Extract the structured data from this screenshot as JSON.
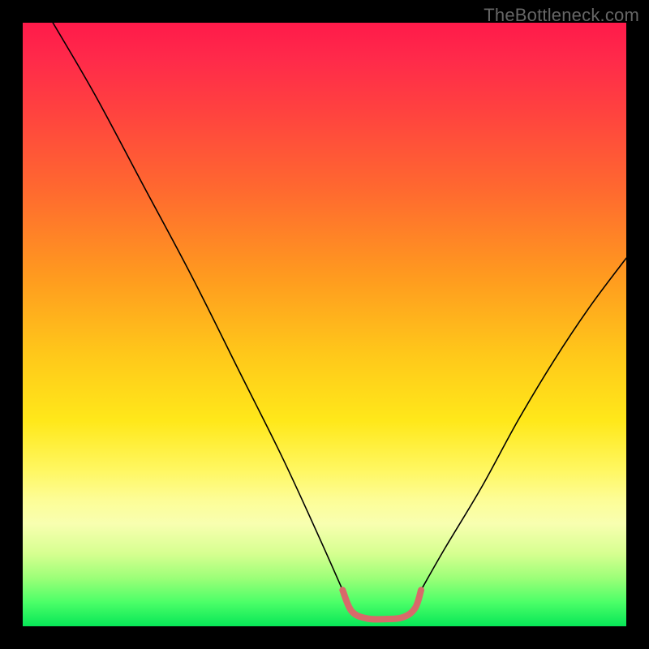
{
  "watermark": "TheBottleneck.com",
  "chart_data": {
    "type": "line",
    "title": "",
    "xlabel": "",
    "ylabel": "",
    "xlim": [
      0,
      100
    ],
    "ylim": [
      0,
      100
    ],
    "grid": false,
    "series": [
      {
        "name": "left-arm",
        "stroke": "#000000",
        "stroke_width": 1.6,
        "points": [
          {
            "x": 5,
            "y": 100
          },
          {
            "x": 12,
            "y": 88
          },
          {
            "x": 20,
            "y": 73
          },
          {
            "x": 28,
            "y": 58
          },
          {
            "x": 36,
            "y": 42
          },
          {
            "x": 43,
            "y": 28
          },
          {
            "x": 49,
            "y": 15
          },
          {
            "x": 53,
            "y": 6
          }
        ]
      },
      {
        "name": "right-arm",
        "stroke": "#000000",
        "stroke_width": 1.6,
        "points": [
          {
            "x": 66,
            "y": 6
          },
          {
            "x": 70,
            "y": 13
          },
          {
            "x": 76,
            "y": 23
          },
          {
            "x": 82,
            "y": 34
          },
          {
            "x": 88,
            "y": 44
          },
          {
            "x": 94,
            "y": 53
          },
          {
            "x": 100,
            "y": 61
          }
        ]
      },
      {
        "name": "bottom-highlight",
        "stroke": "#d86a6a",
        "stroke_width": 8,
        "points": [
          {
            "x": 53,
            "y": 6
          },
          {
            "x": 54.5,
            "y": 2.5
          },
          {
            "x": 57,
            "y": 1.3
          },
          {
            "x": 60,
            "y": 1.2
          },
          {
            "x": 63,
            "y": 1.5
          },
          {
            "x": 65,
            "y": 3
          },
          {
            "x": 66,
            "y": 6
          }
        ]
      }
    ],
    "background": {
      "type": "vertical-gradient",
      "stops": [
        {
          "pos": 0,
          "color": "#ff1a4a"
        },
        {
          "pos": 14,
          "color": "#ff4040"
        },
        {
          "pos": 42,
          "color": "#ff9a1f"
        },
        {
          "pos": 66,
          "color": "#ffe81a"
        },
        {
          "pos": 83,
          "color": "#f8ffb0"
        },
        {
          "pos": 100,
          "color": "#07e657"
        }
      ]
    }
  }
}
